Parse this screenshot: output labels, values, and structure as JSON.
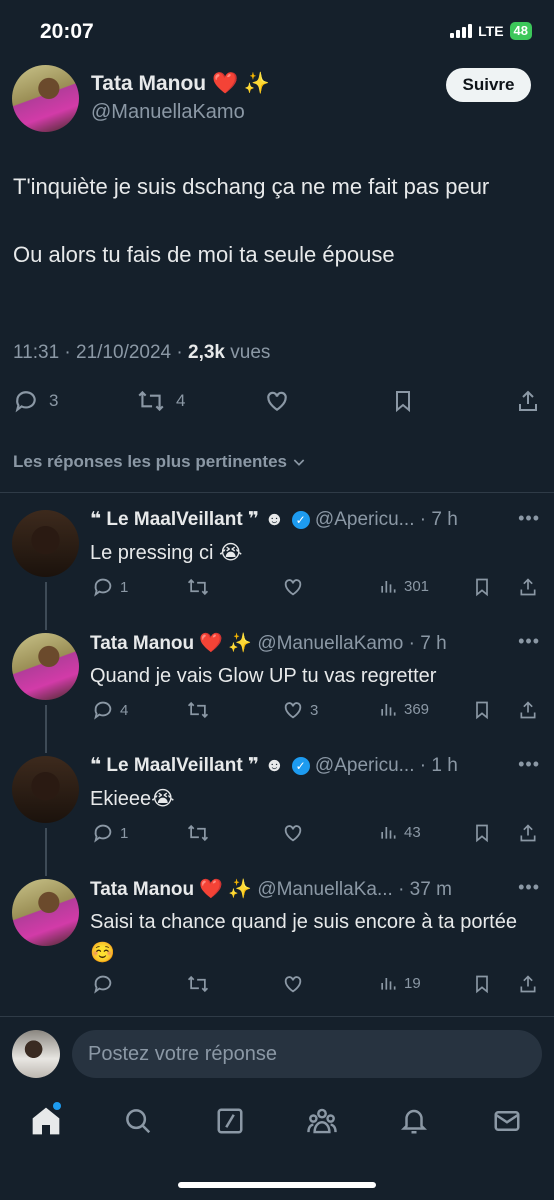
{
  "status_bar": {
    "time": "20:07",
    "network": "LTE",
    "battery": "48"
  },
  "main_tweet": {
    "author_name": "Tata Manou ❤️ ✨",
    "author_handle": "@ManuellaKamo",
    "follow_label": "Suivre",
    "text_line1": "T'inquiète je suis dschang ça ne me fait pas peur",
    "text_line2": "Ou alors tu fais de moi ta seule épouse",
    "timestamp": "11:31 · 21/10/2024 · ",
    "views_count": "2,3k",
    "views_label": " vues",
    "replies": "3",
    "reposts": "4"
  },
  "sort_label": "Les réponses les plus pertinentes",
  "replies": [
    {
      "name": "❝ Le MaalVeillant ❞ ☻",
      "verified": true,
      "handle": "@Apericu...",
      "time": "· 7 h",
      "text": "Le pressing ci 😭",
      "replies": "1",
      "likes": "",
      "views": "301"
    },
    {
      "name": "Tata Manou ❤️ ✨",
      "verified": false,
      "handle": "@ManuellaKamo",
      "time": "· 7 h",
      "text": "Quand je vais Glow UP tu vas regretter",
      "replies": "4",
      "likes": "3",
      "views": "369"
    },
    {
      "name": "❝ Le MaalVeillant ❞ ☻",
      "verified": true,
      "handle": "@Apericu...",
      "time": "· 1 h",
      "text": "Ekieee😭",
      "replies": "1",
      "likes": "",
      "views": "43"
    },
    {
      "name": "Tata Manou ❤️ ✨",
      "verified": false,
      "handle": "@ManuellaKa...",
      "time": "· 37 m",
      "text": "Saisi ta chance quand je suis encore à ta portée ☺️",
      "replies": "",
      "likes": "",
      "views": "19"
    }
  ],
  "composer": {
    "placeholder": "Postez votre réponse"
  },
  "tabs": [
    "home-icon",
    "search-icon",
    "grok-icon",
    "communities-icon",
    "notifications-icon",
    "messages-icon"
  ],
  "colors": {
    "background": "#15202b",
    "accent": "#1d9bf0",
    "muted": "#8b98a5"
  }
}
